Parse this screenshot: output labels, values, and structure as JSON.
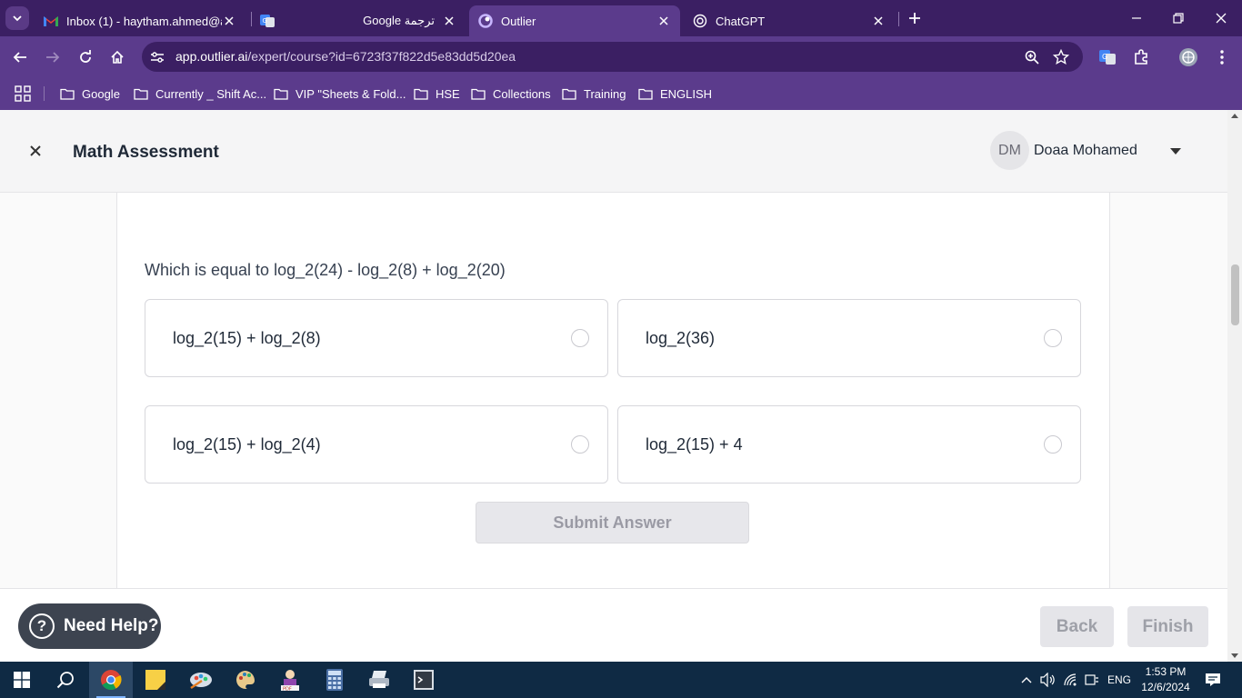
{
  "browser": {
    "tabs": [
      {
        "title": "Inbox (1) - haytham.ahmed@ai",
        "icon": "gmail-icon",
        "active": false
      },
      {
        "title": "Google ترجمة",
        "icon": "google-translate-icon",
        "active": false
      },
      {
        "title": "Outlier",
        "icon": "outlier-icon",
        "active": true
      },
      {
        "title": "ChatGPT",
        "icon": "chatgpt-icon",
        "active": false
      }
    ],
    "address": {
      "host": "app.outlier.ai",
      "path": "/expert/course?id=6723f37f822d5e83dd5d20ea"
    },
    "bookmarks": [
      "Google",
      "Currently _ Shift Ac...",
      "VIP \"Sheets & Fold...",
      "HSE",
      "Collections",
      "Training",
      "ENGLISH"
    ],
    "colors": {
      "frame": "#3b1f63",
      "toolbar": "#5b3b8c"
    }
  },
  "header": {
    "title": "Math Assessment",
    "user": {
      "initials": "DM",
      "name": "Doaa Mohamed"
    }
  },
  "question": {
    "text": "Which is equal to log_2(24) - log_2(8) + log_2(20)",
    "options": [
      "log_2(15) + log_2(8)",
      "log_2(36)",
      "log_2(15) + log_2(4)",
      "log_2(15) + 4"
    ],
    "submit_label": "Submit Answer"
  },
  "footer": {
    "help_label": "Need Help?",
    "back_label": "Back",
    "finish_label": "Finish"
  },
  "taskbar": {
    "language": "ENG",
    "time": "1:53 PM",
    "date": "12/6/2024"
  }
}
